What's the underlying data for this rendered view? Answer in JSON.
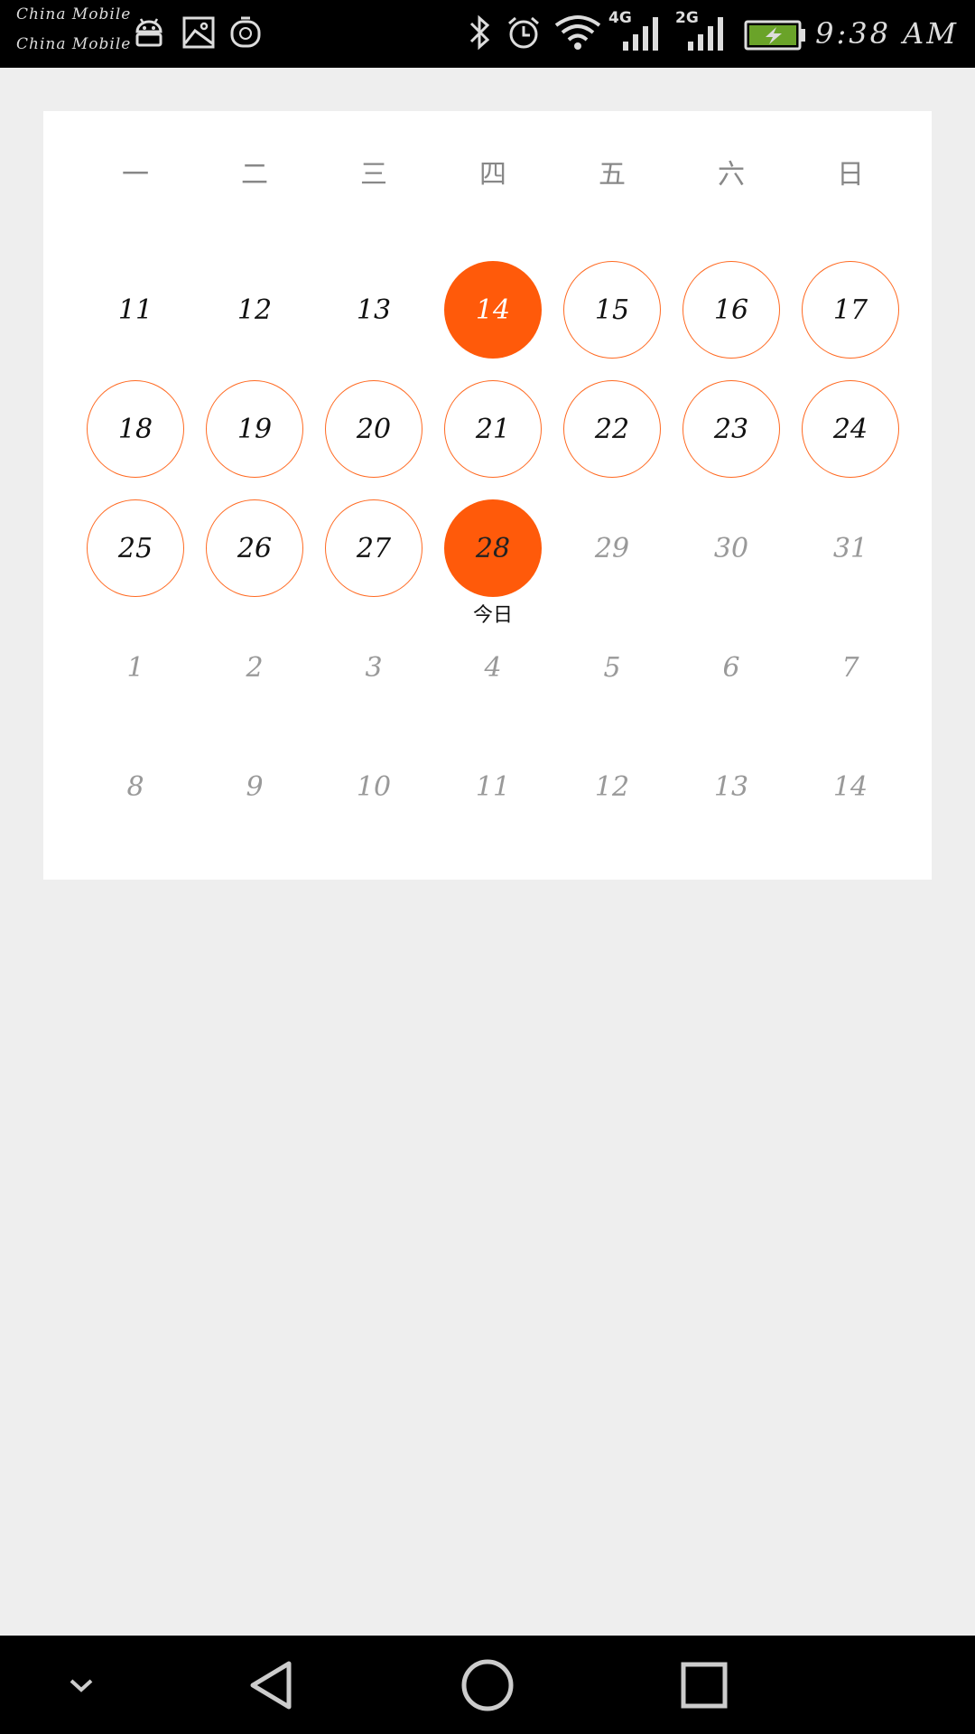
{
  "status_bar": {
    "carrier_1": "China Mobile",
    "carrier_2": "China Mobile",
    "net_1": "4G",
    "net_2": "2G",
    "time": "9:38 AM"
  },
  "calendar": {
    "weekdays": [
      "一",
      "二",
      "三",
      "四",
      "五",
      "六",
      "日"
    ],
    "accent_color": "#ff5a0a",
    "today_label": "今日",
    "weeks": [
      [
        {
          "day": "11",
          "state": "plain"
        },
        {
          "day": "12",
          "state": "plain"
        },
        {
          "day": "13",
          "state": "plain"
        },
        {
          "day": "14",
          "state": "filled"
        },
        {
          "day": "15",
          "state": "marked"
        },
        {
          "day": "16",
          "state": "marked"
        },
        {
          "day": "17",
          "state": "marked"
        }
      ],
      [
        {
          "day": "18",
          "state": "marked"
        },
        {
          "day": "19",
          "state": "marked"
        },
        {
          "day": "20",
          "state": "marked"
        },
        {
          "day": "21",
          "state": "marked"
        },
        {
          "day": "22",
          "state": "marked"
        },
        {
          "day": "23",
          "state": "marked"
        },
        {
          "day": "24",
          "state": "marked"
        }
      ],
      [
        {
          "day": "25",
          "state": "marked"
        },
        {
          "day": "26",
          "state": "marked"
        },
        {
          "day": "27",
          "state": "marked"
        },
        {
          "day": "28",
          "state": "today"
        },
        {
          "day": "29",
          "state": "muted"
        },
        {
          "day": "30",
          "state": "muted"
        },
        {
          "day": "31",
          "state": "muted"
        }
      ],
      [
        {
          "day": "1",
          "state": "muted"
        },
        {
          "day": "2",
          "state": "muted"
        },
        {
          "day": "3",
          "state": "muted"
        },
        {
          "day": "4",
          "state": "muted"
        },
        {
          "day": "5",
          "state": "muted"
        },
        {
          "day": "6",
          "state": "muted"
        },
        {
          "day": "7",
          "state": "muted"
        }
      ],
      [
        {
          "day": "8",
          "state": "muted"
        },
        {
          "day": "9",
          "state": "muted"
        },
        {
          "day": "10",
          "state": "muted"
        },
        {
          "day": "11",
          "state": "muted"
        },
        {
          "day": "12",
          "state": "muted"
        },
        {
          "day": "13",
          "state": "muted"
        },
        {
          "day": "14",
          "state": "muted"
        }
      ]
    ]
  },
  "nav_bar": {
    "buttons": [
      "collapse-icon",
      "back-icon",
      "home-icon",
      "recents-icon"
    ]
  }
}
